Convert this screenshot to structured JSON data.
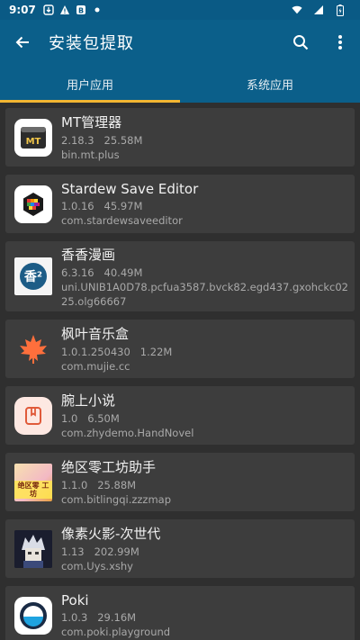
{
  "status": {
    "time": "9:07"
  },
  "toolbar": {
    "title": "安装包提取"
  },
  "tabs": [
    {
      "label": "用户应用"
    },
    {
      "label": "系统应用"
    }
  ],
  "apps": [
    {
      "name": "MT管理器",
      "version": "2.18.3",
      "size": "25.58M",
      "package": "bin.mt.plus",
      "icon": "mt-manager-icon"
    },
    {
      "name": "Stardew Save Editor",
      "version": "1.0.16",
      "size": "45.97M",
      "package": "com.stardewsaveeditor",
      "icon": "stardew-save-editor-icon"
    },
    {
      "name": "香香漫画",
      "version": "6.3.16",
      "size": "40.49M",
      "package": "uni.UNIB1A0D78.pcfua3587.bvck82.egd437.gxohckc0225.olg66667",
      "icon": "xiangxiang-comic-icon",
      "icon_text": "香²"
    },
    {
      "name": "枫叶音乐盒",
      "version": "1.0.1.250430",
      "size": "1.22M",
      "package": "com.mujie.cc",
      "icon": "maple-leaf-icon"
    },
    {
      "name": "腕上小说",
      "version": "1.0",
      "size": "6.50M",
      "package": "com.zhydemo.HandNovel",
      "icon": "wrist-novel-icon"
    },
    {
      "name": "绝区零工坊助手",
      "version": "1.1.0",
      "size": "25.88M",
      "package": "com.bitlingqi.zzzmap",
      "icon": "zzz-workshop-icon",
      "icon_text": "绝区零 工坊"
    },
    {
      "name": "像素火影-次世代",
      "version": "1.13",
      "size": "202.99M",
      "package": "com.Uys.xshy",
      "icon": "pixel-naruto-icon"
    },
    {
      "name": "Poki",
      "version": "1.0.3",
      "size": "29.16M",
      "package": "com.poki.playground",
      "icon": "poki-icon"
    }
  ],
  "colors": {
    "appbar": "#0b5f8a",
    "tab_indicator": "#f2b632",
    "card": "#3d3d3d",
    "background": "#2f2f2f"
  }
}
